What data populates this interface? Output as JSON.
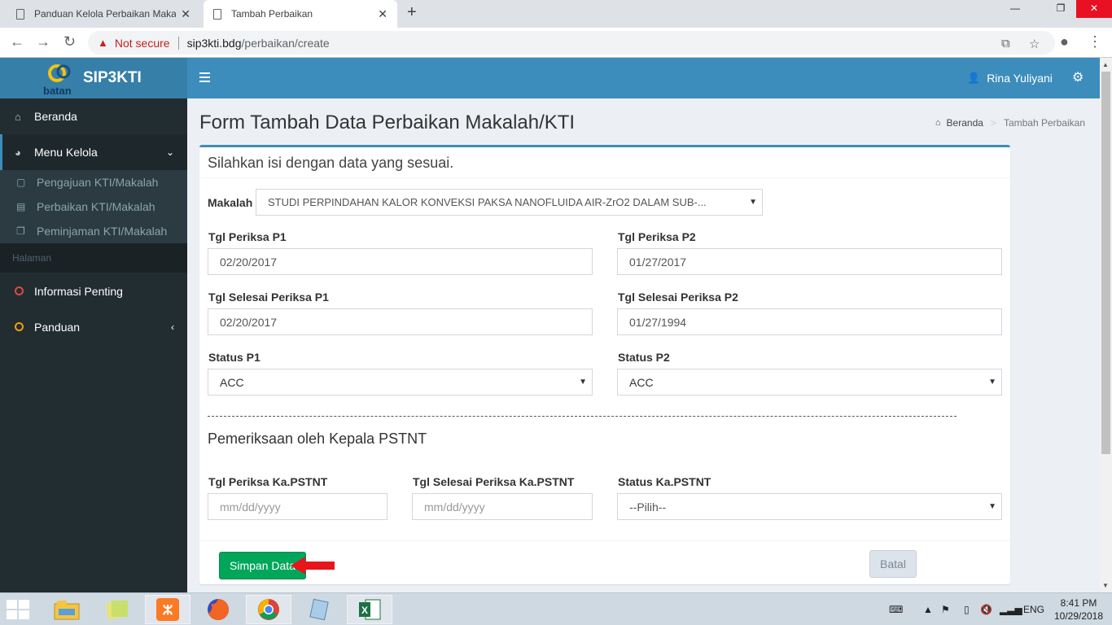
{
  "browser": {
    "tabs": [
      {
        "title": "Panduan Kelola Perbaikan Makal"
      },
      {
        "title": "Tambah Perbaikan"
      }
    ],
    "security_label": "Not secure",
    "url_host": "sip3kti.bdg",
    "url_path": "/perbaikan/create"
  },
  "app": {
    "logo_text": "SIP3KTI",
    "logo_sub": "batan",
    "user_name": "Rina Yuliyani"
  },
  "sidebar": {
    "items": [
      {
        "label": "Beranda",
        "icon": "home-icon"
      },
      {
        "label": "Menu Kelola",
        "icon": "dashboard-icon"
      }
    ],
    "sub_items": [
      {
        "label": "Pengajuan KTI/Makalah",
        "icon": "file-icon"
      },
      {
        "label": "Perbaikan KTI/Makalah",
        "icon": "file-text-icon"
      },
      {
        "label": "Peminjaman KTI/Makalah",
        "icon": "copy-icon"
      }
    ],
    "header": "Halaman",
    "bottom_items": [
      {
        "label": "Informasi Penting",
        "color": "#dd4b39"
      },
      {
        "label": "Panduan",
        "color": "#f39c12"
      }
    ]
  },
  "page": {
    "title": "Form Tambah Data Perbaikan Makalah/KTI",
    "breadcrumb": {
      "home": "Beranda",
      "current": "Tambah Perbaikan"
    }
  },
  "form": {
    "header": "Silahkan isi dengan data yang sesuai.",
    "makalah_label": "Makalah",
    "makalah_value": "STUDI PERPINDAHAN KALOR KONVEKSI PAKSA NANOFLUIDA AIR-ZrO2 DALAM SUB-...",
    "tgl_periksa_p1_label": "Tgl Periksa P1",
    "tgl_periksa_p1_value": "02/20/2017",
    "tgl_periksa_p2_label": "Tgl Periksa P2",
    "tgl_periksa_p2_value": "01/27/2017",
    "tgl_selesai_p1_label": "Tgl Selesai Periksa P1",
    "tgl_selesai_p1_value": "02/20/2017",
    "tgl_selesai_p2_label": "Tgl Selesai Periksa P2",
    "tgl_selesai_p2_value": "01/27/1994",
    "status_p1_label": "Status P1",
    "status_p1_value": "ACC",
    "status_p2_label": "Status P2",
    "status_p2_value": "ACC",
    "section_title": "Pemeriksaan oleh Kepala PSTNT",
    "tgl_periksa_ka_label": "Tgl Periksa Ka.PSTNT",
    "tgl_periksa_ka_placeholder": "mm/dd/yyyy",
    "tgl_selesai_ka_label": "Tgl Selesai Periksa Ka.PSTNT",
    "tgl_selesai_ka_placeholder": "mm/dd/yyyy",
    "status_ka_label": "Status Ka.PSTNT",
    "status_ka_value": "--Pilih--",
    "save_label": "Simpan Data",
    "cancel_label": "Batal"
  },
  "taskbar": {
    "language": "ENG",
    "time": "8:41 PM",
    "date": "10/29/2018"
  },
  "colors": {
    "header_blue": "#3c8dbc",
    "sidebar_dark": "#222d32",
    "save_green": "#00a65a",
    "annotation_red": "#e8151b"
  }
}
